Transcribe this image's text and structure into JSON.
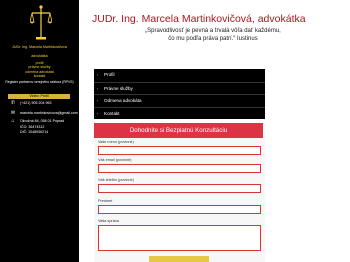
{
  "site": {
    "title": "JUDr. Ing. Marcela Martinkovičová, advokátka"
  },
  "quote": {
    "line1": "„Spravodlivosť je pevná a trvalá vôľa dať každému,",
    "line2": "čo mu podľa práva patrí.“ Iustinus"
  },
  "sidebar": {
    "name": "JUDr. Ing. Marcela Martinkovičová",
    "title": "advokátka",
    "items": [
      "profil",
      "právne služby",
      "odmena advokáta",
      "kontakt"
    ],
    "registry": "Register partnerov verejného sektora (RPVS)",
    "highlight": "Video: Profil",
    "contacts": [
      {
        "icon": "phone-icon",
        "glyph": "✆",
        "text": "(+421) 905 204 963"
      },
      {
        "icon": "email-icon",
        "glyph": "✉",
        "text": "marcela.martinkovicova@gmail.com"
      },
      {
        "icon": "location-icon",
        "glyph": "⌂",
        "text": "Okružná 84, 058 01 Poprad"
      },
      {
        "icon": "id-icon",
        "glyph": "",
        "text": "IČO: 36474312"
      },
      {
        "icon": "tax-icon",
        "glyph": "",
        "text": "DIČ: 1048936214"
      }
    ]
  },
  "nav": {
    "items": [
      {
        "label": "Profil"
      },
      {
        "label": "Právne služby"
      },
      {
        "label": "Odmena advokáta"
      },
      {
        "label": "Kontakt"
      }
    ],
    "caret": "›"
  },
  "form": {
    "header": "Dohodnite si Bezplatnú Konzultáciu",
    "fields": {
      "name_label": "Vaše meno (povinné)",
      "email_label": "Váš email (povinné)",
      "phone_label": "Váš telefón (povinné)",
      "subject_label": "Predmet",
      "message_label": "Vaša správa"
    }
  },
  "colors": {
    "accent_red": "#b0141c",
    "form_header": "#dc3445",
    "gold": "#f5d23a",
    "sidebar": "#000000"
  }
}
